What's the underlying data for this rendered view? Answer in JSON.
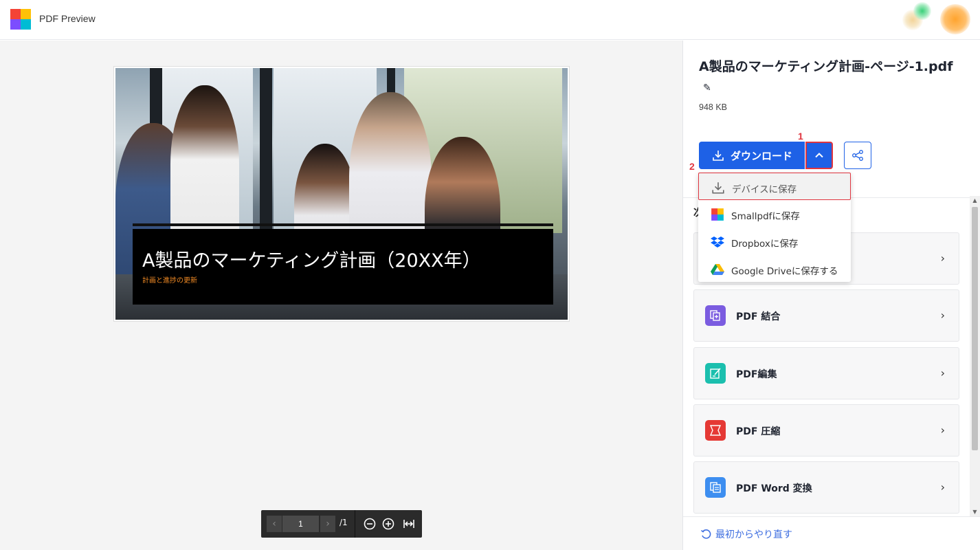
{
  "app": {
    "title": "PDF Preview"
  },
  "document": {
    "banner_title": "A製品のマーケティング計画（20XX年）",
    "banner_subtitle": "計画と進捗の更新"
  },
  "pagebar": {
    "current_page": "1",
    "total_pages": "/1"
  },
  "file": {
    "name": "A製品のマーケティング計画-ページ-1.pdf",
    "size": "948 KB"
  },
  "actions": {
    "download_label": "ダウンロード"
  },
  "markers": {
    "one": "1",
    "two": "2"
  },
  "dropdown": {
    "items": [
      {
        "label": "デバイスに保存",
        "icon": "download-icon"
      },
      {
        "label": "Smallpdfに保存",
        "icon": "smallpdf-icon"
      },
      {
        "label": "Dropboxに保存",
        "icon": "dropbox-icon"
      },
      {
        "label": "Google Driveに保存する",
        "icon": "google-drive-icon"
      }
    ]
  },
  "tools": {
    "heading_partial": "次",
    "items": [
      {
        "label": "",
        "color": "#f7f7f8"
      },
      {
        "label": "PDF 結合",
        "color": "#7b5ce0"
      },
      {
        "label": "PDF編集",
        "color": "#1bbfae"
      },
      {
        "label": "PDF 圧縮",
        "color": "#e53935"
      },
      {
        "label": "PDF Word 変換",
        "color": "#3d8ef0"
      }
    ]
  },
  "footer": {
    "restart_label": "最初からやり直す"
  },
  "colors": {
    "primary": "#1e61e6",
    "highlight": "#e0353f",
    "link": "#3f6fe0"
  }
}
